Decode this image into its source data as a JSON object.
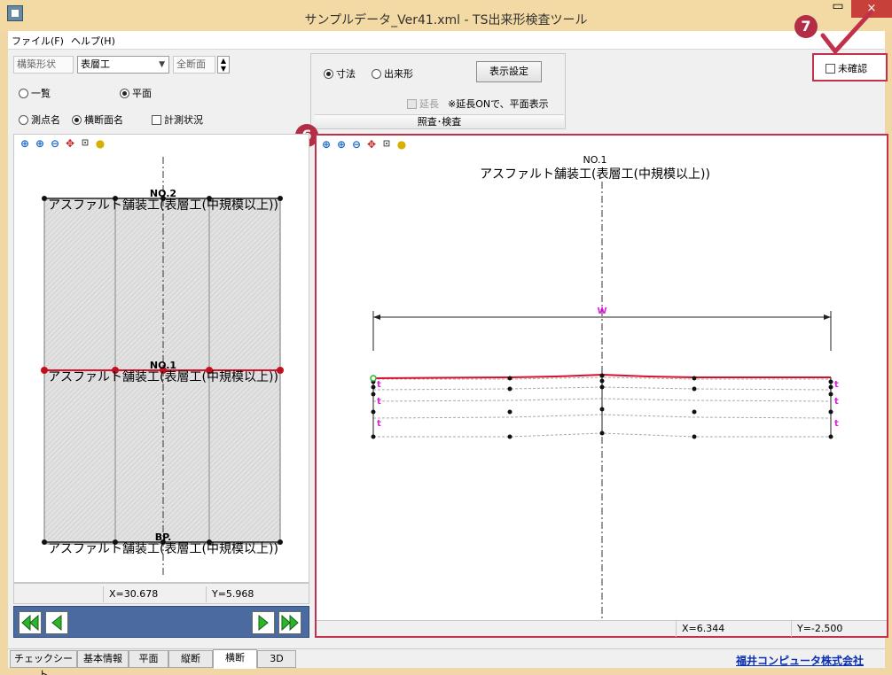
{
  "window": {
    "title": "サンプルデータ_Ver41.xml - TS出来形検査ツール",
    "minimize_glyph": "▭",
    "close_glyph": "×"
  },
  "menu": {
    "items": [
      "ファイル(F)",
      "ヘルプ(H)"
    ]
  },
  "left_controls": {
    "structure_label": "構築形状",
    "structure_value": "表層工",
    "all_sections_label": "全断面",
    "radio_list": "一覧",
    "radio_plan": "平面",
    "radio_point_name": "測点名",
    "radio_section_name": "横断面名",
    "check_measurement_status": "計測状況"
  },
  "mid_controls": {
    "radio_dimension": "寸法",
    "radio_as_built": "出来形",
    "display_settings_button": "表示設定",
    "extend_label": "延長",
    "extend_note": "※延長ONで、平面表示",
    "panel_header": "照査･検査"
  },
  "unconfirmed": {
    "label": "未確認"
  },
  "callouts": {
    "six": "6",
    "seven": "7"
  },
  "left_view": {
    "label_no2": "NO.2",
    "label_no1": "NO.1",
    "label_bp": "BP.",
    "section_name": "アスファルト舗装工(表層工(中規模以上))",
    "x_readout": "X=30.678",
    "y_readout": "Y=5.968"
  },
  "right_view": {
    "label_no1": "NO.1",
    "section_name": "アスファルト舗装工(表層工(中規模以上))",
    "w_label": "W",
    "t_label": "t",
    "x_readout": "X=6.344",
    "y_readout": "Y=-2.500"
  },
  "tabs": [
    "チェックシート",
    "基本情報",
    "平面",
    "縦断",
    "横断",
    "3D"
  ],
  "company_link": "福井コンピュータ株式会社",
  "colors": {
    "accent_red": "#c3304a",
    "profile_red": "#d8102a",
    "magenta_label": "#e020e0",
    "nav_blue": "#4b6aa0",
    "link_blue": "#0b2fb0"
  }
}
